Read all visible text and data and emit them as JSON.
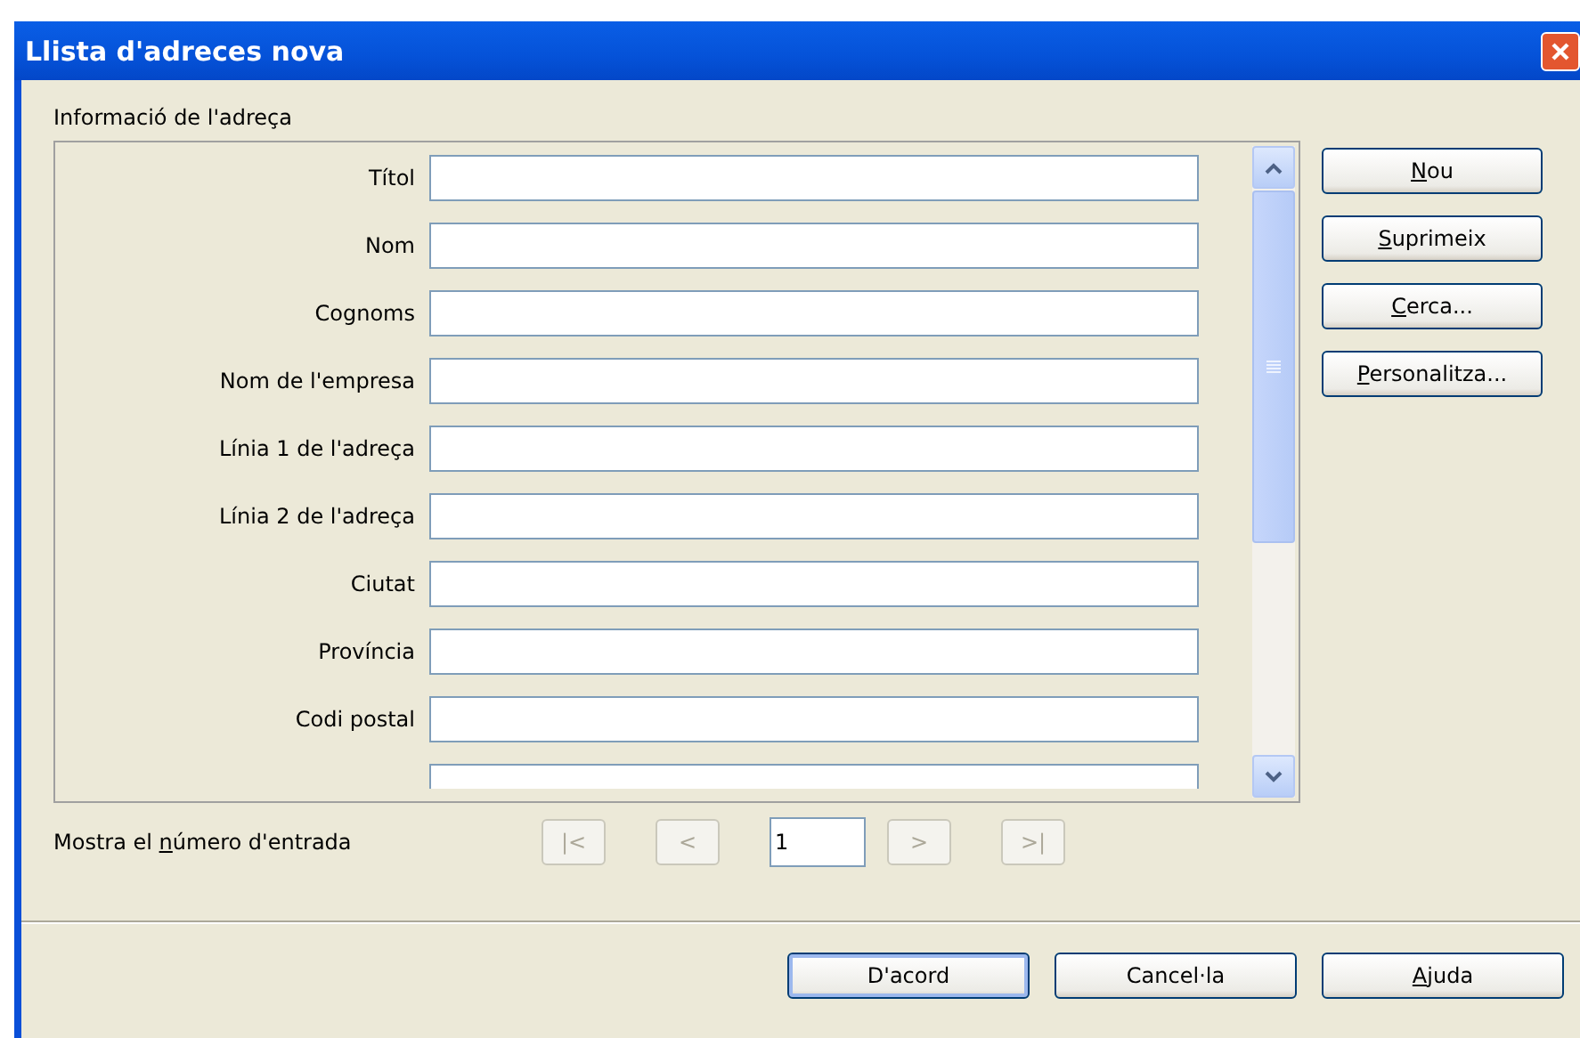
{
  "window": {
    "title": "Llista d'adreces nova"
  },
  "group": {
    "label": "Informació de l'adreça"
  },
  "fields": [
    {
      "label": "Títol",
      "cut_off": false
    },
    {
      "label": "Nom",
      "cut_off": false
    },
    {
      "label": "Cognoms",
      "cut_off": false
    },
    {
      "label": "Nom de l'empresa",
      "cut_off": false
    },
    {
      "label": "Línia 1 de l'adreça",
      "cut_off": false
    },
    {
      "label": "Línia 2 de l'adreça",
      "cut_off": false
    },
    {
      "label": "Ciutat",
      "cut_off": false
    },
    {
      "label": "Província",
      "cut_off": false
    },
    {
      "label": "Codi postal",
      "cut_off": false
    },
    {
      "cut_off": true
    }
  ],
  "side_buttons": [
    {
      "key": "N",
      "after": "ou"
    },
    {
      "key": "S",
      "after": "uprimeix"
    },
    {
      "key": "C",
      "after": "erca..."
    },
    {
      "key": "P",
      "after": "ersonalitza..."
    }
  ],
  "navigation": {
    "label": {
      "before": "Mostra el ",
      "key": "n",
      "after": "úmero d'entrada"
    },
    "buttons": [
      {
        "text": "|<",
        "disabled": true
      },
      {
        "text": "<",
        "disabled": true
      },
      {
        "text": ">",
        "disabled": true
      },
      {
        "text": ">|",
        "disabled": true
      }
    ],
    "entry": "1"
  },
  "footer_buttons": [
    {
      "before": "D'acord",
      "default": true
    },
    {
      "before": "Cancel·la",
      "default": false
    },
    {
      "key": "A",
      "after": "juda",
      "default": false
    }
  ]
}
